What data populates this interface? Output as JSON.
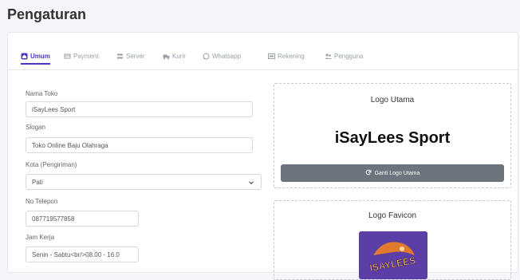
{
  "page": {
    "title": "Pengaturan"
  },
  "tabs": [
    {
      "label": "Umum",
      "icon": "home-icon"
    },
    {
      "label": "Payment",
      "icon": "payment-icon"
    },
    {
      "label": "Server",
      "icon": "server-icon"
    },
    {
      "label": "Kurir",
      "icon": "truck-icon"
    },
    {
      "label": "Whatsapp",
      "icon": "whatsapp-icon"
    },
    {
      "label": "Rekening",
      "icon": "bank-icon"
    },
    {
      "label": "Pengguna",
      "icon": "users-icon"
    }
  ],
  "form": {
    "store_name": {
      "label": "Nama Toko",
      "value": "iSayLees Sport"
    },
    "slogan": {
      "label": "Slogan",
      "value": "Toko Online Baju Olahraga"
    },
    "city": {
      "label": "Kota (Pengiriman)",
      "value": "Pati"
    },
    "phone": {
      "label": "No Telepon",
      "value": "087719577858"
    },
    "hours": {
      "label": "Jam Kerja",
      "value": "Senin - Sabtu<br/>08.00 - 16.0"
    }
  },
  "logo_panel": {
    "title": "Logo Utama",
    "logo_text": "iSayLees Sport",
    "button_label": "Ganti Logo Utama",
    "button_icon": "refresh-icon"
  },
  "favicon_panel": {
    "title": "Logo Favicon",
    "favicon_text": "ISAYLEES"
  },
  "colors": {
    "accent": "#4b35c4",
    "button": "#6c757d",
    "favicon_bg": "#5b3fa6"
  }
}
